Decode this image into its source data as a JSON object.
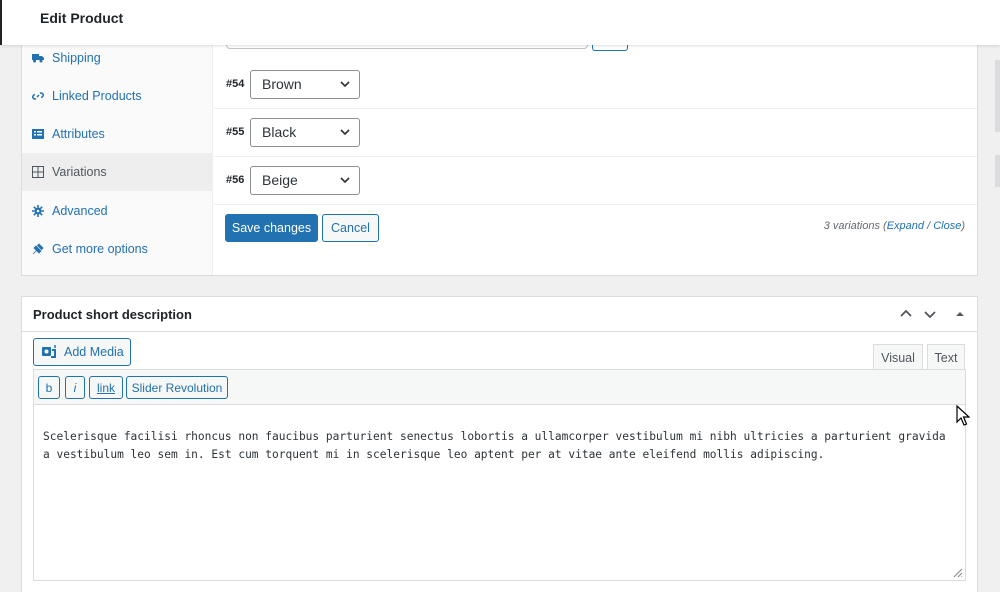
{
  "topbar": {
    "title": "Edit Product"
  },
  "product_data": {
    "tabs": [
      {
        "label": "Shipping",
        "icon": "truck-icon"
      },
      {
        "label": "Linked Products",
        "icon": "link-icon"
      },
      {
        "label": "Attributes",
        "icon": "list-icon"
      },
      {
        "label": "Variations",
        "icon": "grid-icon",
        "active": true
      },
      {
        "label": "Advanced",
        "icon": "gear-icon"
      },
      {
        "label": "Get more options",
        "icon": "plugin-icon"
      }
    ],
    "variations": [
      {
        "id": "#54",
        "value": "Brown"
      },
      {
        "id": "#55",
        "value": "Black"
      },
      {
        "id": "#56",
        "value": "Beige"
      }
    ],
    "save_label": "Save changes",
    "cancel_label": "Cancel",
    "count_text": "3 variations (",
    "expand_label": "Expand",
    "separator": " / ",
    "close_label": "Close",
    "count_end": ")"
  },
  "short_description": {
    "title": "Product short description",
    "add_media_label": "Add Media",
    "tab_visual": "Visual",
    "tab_text": "Text",
    "quicktags": {
      "bold": "b",
      "italic": "i",
      "link": "link",
      "slider": "Slider Revolution"
    },
    "content": "Scelerisque facilisi rhoncus non faucibus parturient senectus lobortis a ullamcorper vestibulum mi nibh ultricies a parturient gravida a vestibulum leo sem in. Est cum torquent mi in scelerisque leo aptent per at vitae ante eleifend mollis adipiscing."
  },
  "colors": {
    "primary": "#2271b1",
    "text": "#2c3338",
    "border": "#dcdcde"
  }
}
